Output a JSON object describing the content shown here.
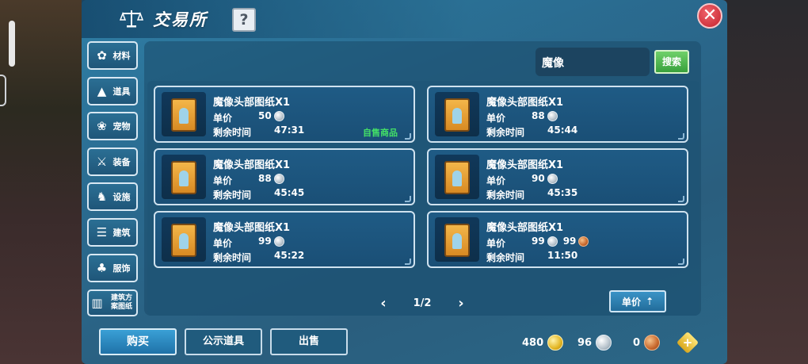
{
  "header": {
    "title": "交易所",
    "help_label": "?",
    "close_label": "✕"
  },
  "sidebar": {
    "items": [
      {
        "label": "材料",
        "icon": "materials-icon"
      },
      {
        "label": "道具",
        "icon": "flask-icon"
      },
      {
        "label": "宠物",
        "icon": "paw-icon"
      },
      {
        "label": "装备",
        "icon": "sword-icon"
      },
      {
        "label": "设施",
        "icon": "mount-icon"
      },
      {
        "label": "建筑",
        "icon": "building-icon"
      },
      {
        "label": "服饰",
        "icon": "clothing-icon"
      },
      {
        "label": "建筑方案图纸",
        "icon": "blueprint-icon"
      }
    ]
  },
  "search": {
    "value": "魔像",
    "button_label": "搜索"
  },
  "listing": {
    "price_key": "单价",
    "time_key": "剩余时间",
    "items": [
      {
        "name": "魔像头部图纸X1",
        "silver": "50",
        "copper": "",
        "time": "47:31",
        "own_label": "自售商品"
      },
      {
        "name": "魔像头部图纸X1",
        "silver": "88",
        "copper": "",
        "time": "45:44",
        "own_label": ""
      },
      {
        "name": "魔像头部图纸X1",
        "silver": "88",
        "copper": "",
        "time": "45:45",
        "own_label": ""
      },
      {
        "name": "魔像头部图纸X1",
        "silver": "90",
        "copper": "",
        "time": "45:35",
        "own_label": ""
      },
      {
        "name": "魔像头部图纸X1",
        "silver": "99",
        "copper": "",
        "time": "45:22",
        "own_label": ""
      },
      {
        "name": "魔像头部图纸X1",
        "silver": "99",
        "copper": "99",
        "time": "11:50",
        "own_label": ""
      }
    ]
  },
  "pager": {
    "page": "1/2",
    "prev": "‹",
    "next": "›"
  },
  "sort": {
    "label": "单价",
    "arrow": "⇡"
  },
  "bottom": {
    "buy_label": "购买",
    "public_label": "公示道具",
    "sell_label": "出售",
    "gold": "480",
    "silver": "96",
    "copper": "0",
    "add_label": "+"
  },
  "colors": {
    "accent_green": "#43e067",
    "panel": "#1f5b85",
    "close_red": "#c3222d"
  }
}
